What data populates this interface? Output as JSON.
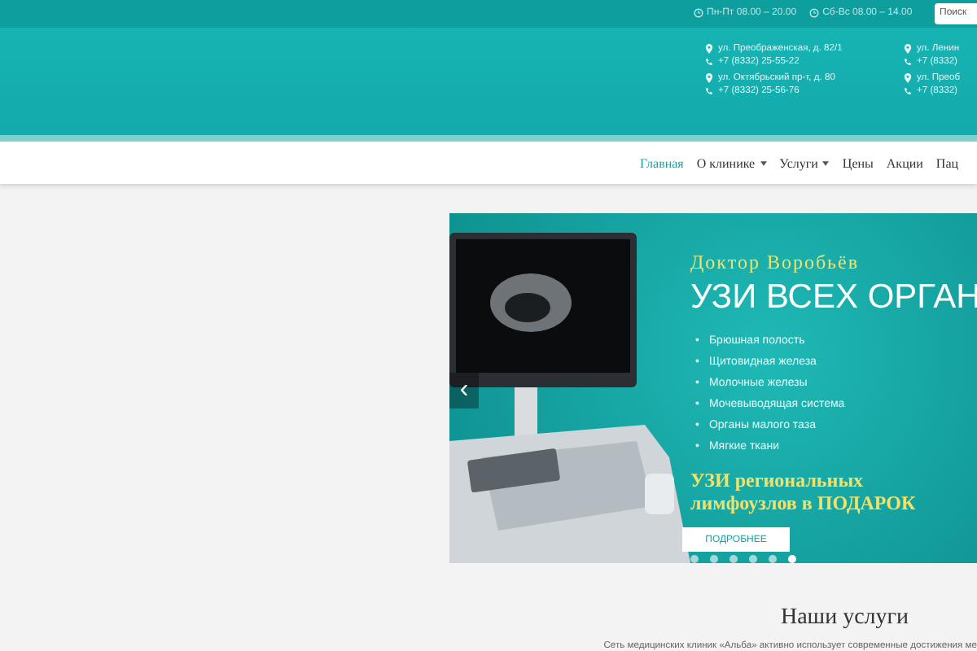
{
  "top_bar": {
    "hours": [
      "Пн-Пт 08.00 – 20.00",
      "Сб-Вс 08.00 – 14.00"
    ],
    "search": {
      "placeholder": "Поиск"
    }
  },
  "header": {
    "contacts": [
      {
        "address": "ул. Преображенская, д. 82/1",
        "phone": "+7 (8332) 25-55-22"
      },
      {
        "address": "ул. Октябрьский пр-т, д. 80",
        "phone": "+7 (8332) 25-56-76"
      },
      {
        "address": "ул. Ленин",
        "phone": "+7 (8332)"
      },
      {
        "address": "ул. Преоб",
        "phone": "+7 (8332)"
      }
    ]
  },
  "nav": [
    {
      "label": "Главная",
      "selected": true,
      "dropdown": false
    },
    {
      "label": "О клинике",
      "selected": false,
      "dropdown": true
    },
    {
      "label": "Услуги",
      "selected": false,
      "dropdown": true
    },
    {
      "label": "Цены",
      "selected": false,
      "dropdown": false
    },
    {
      "label": "Акции",
      "selected": false,
      "dropdown": false
    },
    {
      "label": "Пац",
      "selected": false,
      "dropdown": false
    }
  ],
  "slider": {
    "subtitle": "Доктор Воробьёв",
    "title": "УЗИ ВСЕХ ОРГАН",
    "items": [
      "Брюшная полость",
      "Щитовидная железа",
      "Молочные железы",
      "Мочевыводящая система",
      "Органы малого таза",
      "Мягкие ткани"
    ],
    "bullet": "•",
    "promo": "УЗИ региональных лимфоузлов в ПОДАРОК",
    "button": "ПОДРОБНЕЕ",
    "prev": "‹",
    "dots": [
      {
        "selected": false
      },
      {
        "selected": false
      },
      {
        "selected": false
      },
      {
        "selected": false
      },
      {
        "selected": false
      },
      {
        "selected": true
      }
    ]
  },
  "services": {
    "title": "Наши услуги",
    "text": "Сеть медицинских клиник «Альба» активно использует современные достижения ме"
  }
}
